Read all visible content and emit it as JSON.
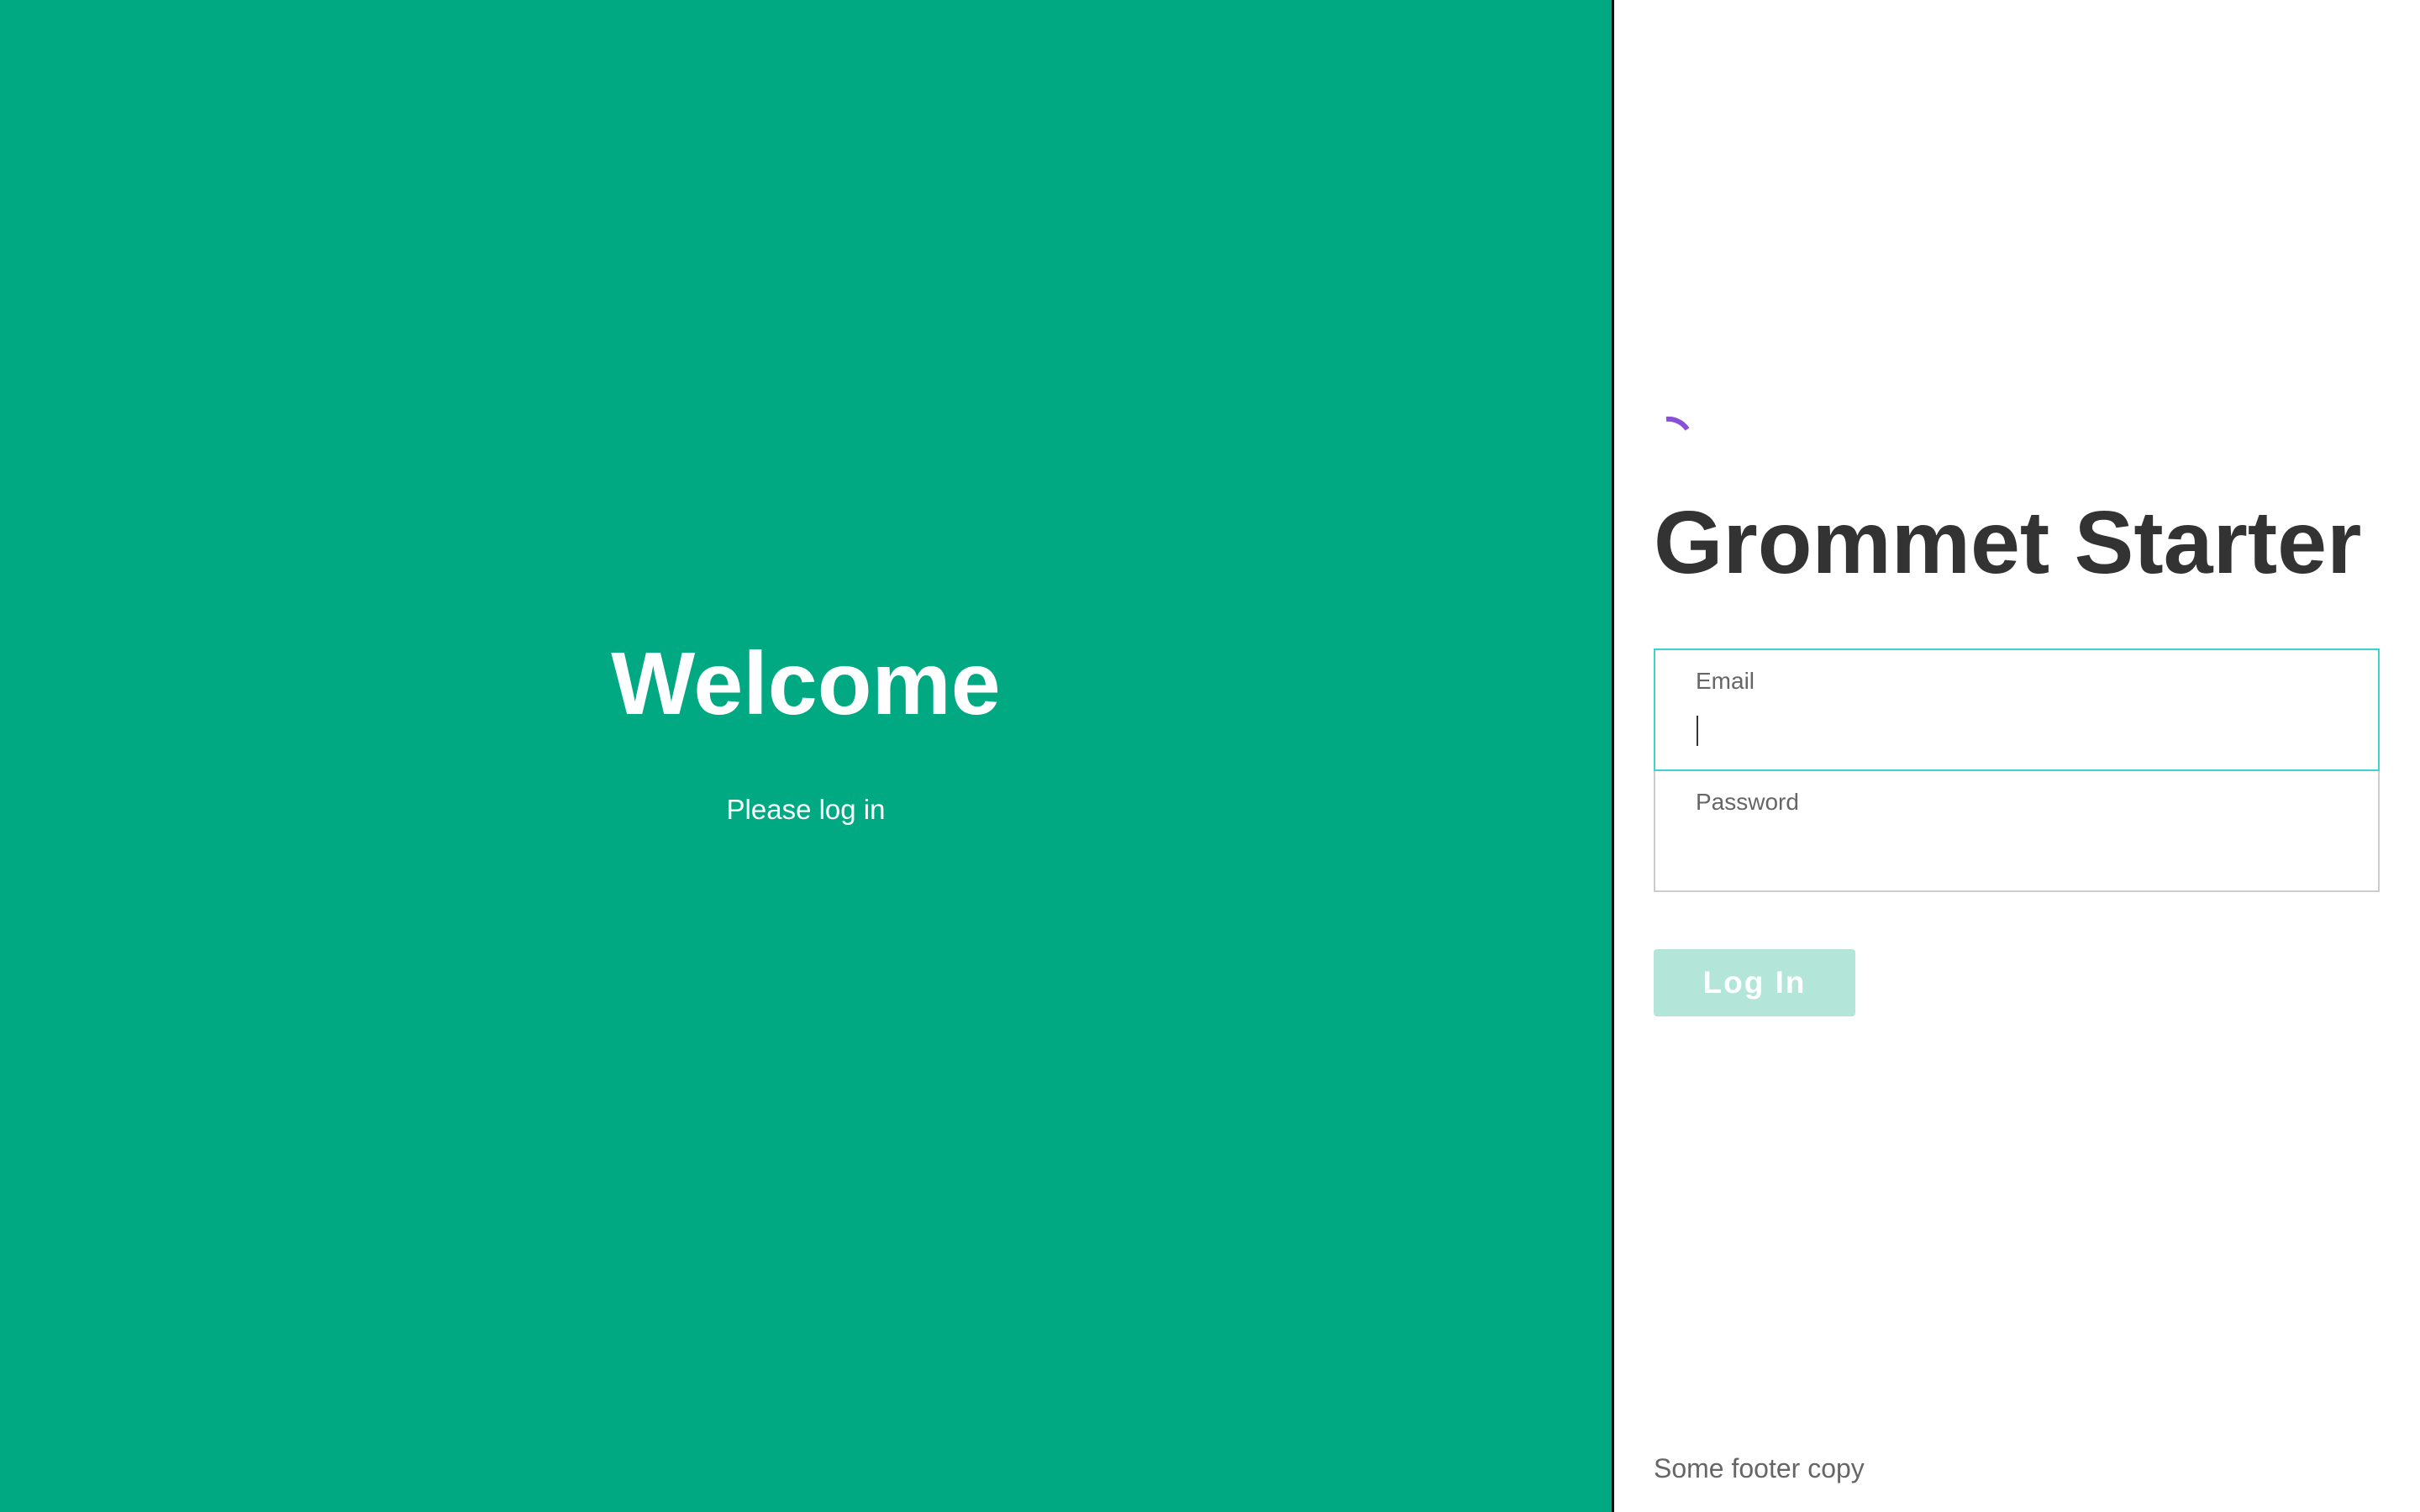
{
  "splash": {
    "title": "Welcome",
    "subtitle": "Please log in",
    "background": "#00a982"
  },
  "panel": {
    "loading_icon": "spinner-icon",
    "app_title": "Grommet Starter",
    "form": {
      "email_label": "Email",
      "email_value": "",
      "password_label": "Password",
      "password_value": "",
      "submit_label": "Log In"
    },
    "footer": "Some footer copy"
  },
  "colors": {
    "brand": "#00a982",
    "focus_border": "#3fd4c9",
    "spinner": "#8a4fd8",
    "button_disabled": "#b3e5d9",
    "text_dark": "#333333"
  }
}
